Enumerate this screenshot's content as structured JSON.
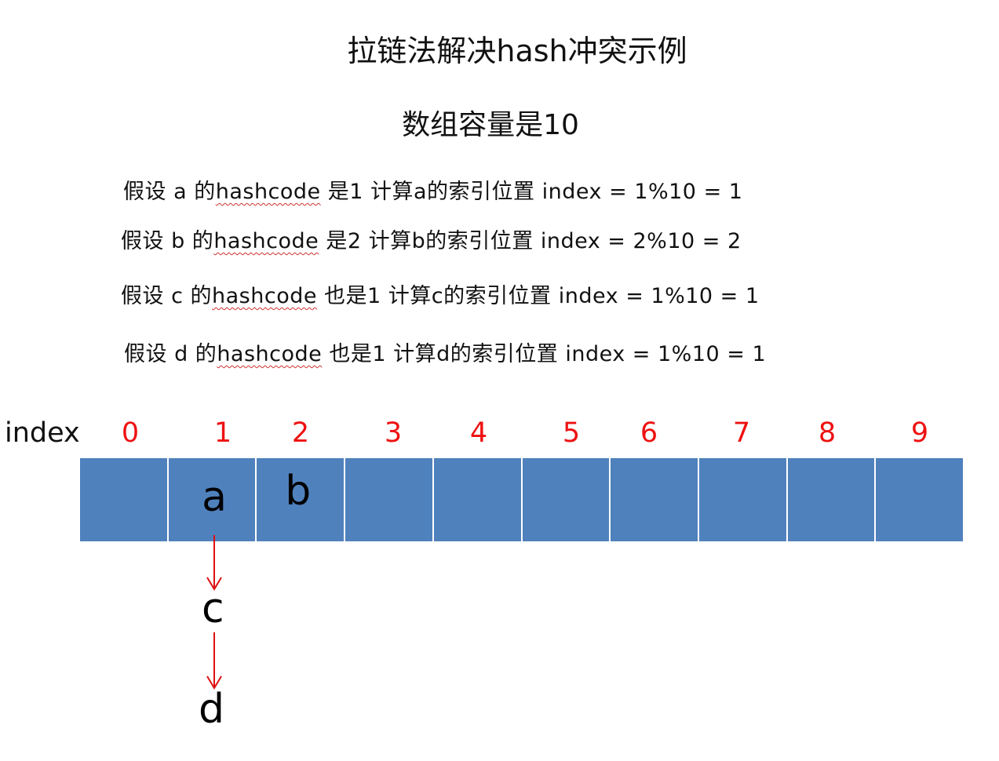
{
  "title": "拉链法解决hash冲突示例",
  "subtitle": "数组容量是10",
  "lines": [
    {
      "pre": "假设 a 的",
      "code": "hashcode",
      "post": " 是1  计算a的索引位置 index = 1%10 = 1"
    },
    {
      "pre": "假设 b 的",
      "code": "hashcode",
      "post": " 是2  计算b的索引位置 index = 2%10 = 2"
    },
    {
      "pre": "假设 c 的",
      "code": "hashcode",
      "post": " 也是1  计算c的索引位置 index = 1%10 = 1"
    },
    {
      "pre": "假设 d 的",
      "code": "hashcode",
      "post": " 也是1  计算d的索引位置 index = 1%10 = 1"
    }
  ],
  "index_label": "index",
  "indices": [
    "0",
    "1",
    "2",
    "3",
    "4",
    "5",
    "6",
    "7",
    "8",
    "9"
  ],
  "cells": [
    "",
    "a",
    "b",
    "",
    "",
    "",
    "",
    "",
    "",
    ""
  ],
  "chain": [
    "c",
    "d"
  ],
  "colors": {
    "cell_fill": "#4f81bd",
    "index_numbers": "#ee1111",
    "arrows": "#dd1111"
  }
}
